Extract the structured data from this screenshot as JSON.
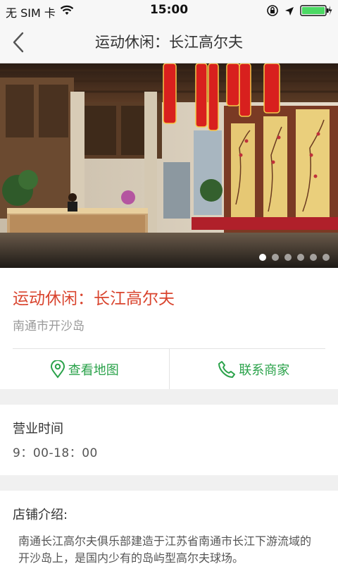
{
  "status_bar": {
    "carrier": "无 SIM 卡",
    "time": "15:00"
  },
  "nav": {
    "title": "运动休闲：长江高尔夫"
  },
  "gallery": {
    "slide_count": 6,
    "active_index": 0
  },
  "shop": {
    "name": "运动休闲：长江高尔夫",
    "address": "南通市开沙岛",
    "map_label": "查看地图",
    "contact_label": "联系商家"
  },
  "hours": {
    "title": "营业时间",
    "value": "9：00-18：00"
  },
  "intro": {
    "title": "店铺介绍:",
    "body": "南通长江高尔夫俱乐部建造于江苏省南通市长江下游流域的开沙岛上，是国内少有的岛屿型高尔夫球场。"
  },
  "colors": {
    "accent": "#d9452f",
    "action": "#2aa24a"
  }
}
